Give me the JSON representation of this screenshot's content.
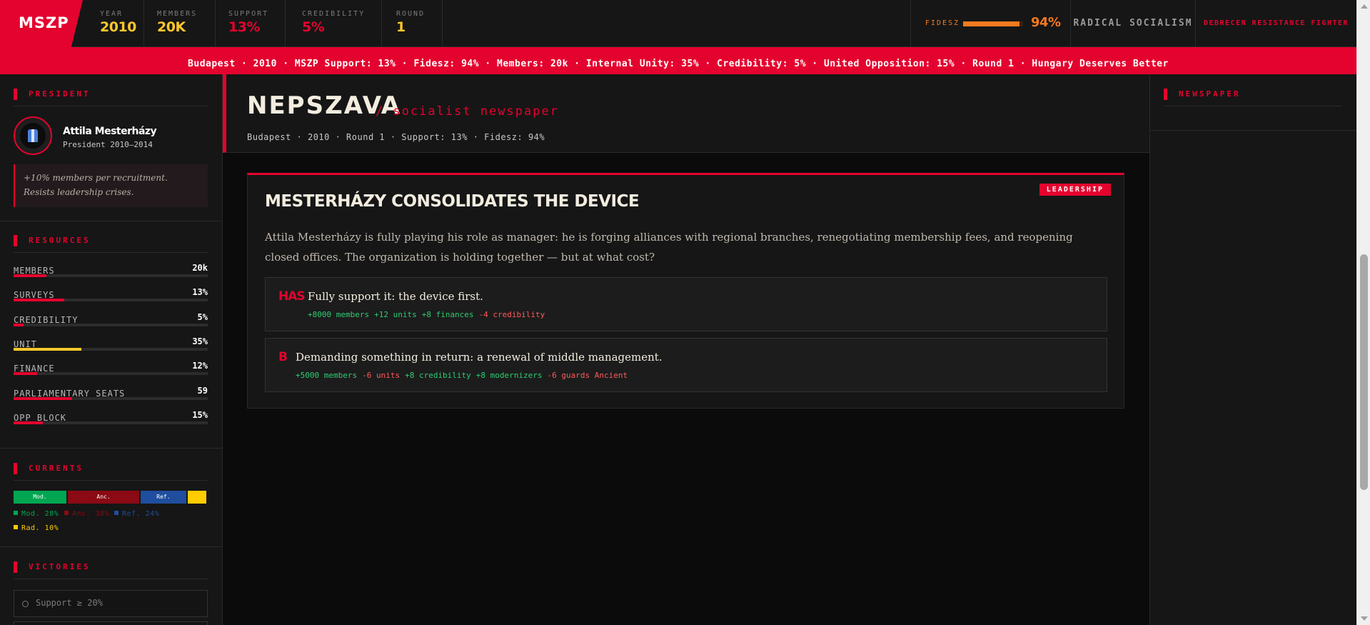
{
  "app": {
    "logo": "MSZP"
  },
  "stats": [
    {
      "label": "YEAR",
      "value": "2010",
      "color": "yellow"
    },
    {
      "label": "MEMBERS",
      "value": "20K",
      "color": "yellow"
    },
    {
      "label": "SUPPORT",
      "value": "13%",
      "color": "red"
    },
    {
      "label": "CREDIBILITY",
      "value": "5%",
      "color": "red"
    },
    {
      "label": "ROUND",
      "value": "1",
      "color": "yellow"
    }
  ],
  "fidesz": {
    "label": "FIDESZ",
    "value": "94%",
    "level": 0.94,
    "color": "#f47a1f"
  },
  "ideology": "RADICAL SOCIALISM",
  "role": "DEBRECEN RESISTANCE FIGHTER",
  "ticker": "Budapest · 2010 · MSZP Support: 13% · Fidesz: 94% · Members: 20k · Internal Unity: 35% · Credibility: 5% · United Opposition: 15% · Round 1 · Hungary Deserves Better",
  "sidebar": {
    "president": {
      "title": "PRESIDENT",
      "name": "Attila Mesterházy",
      "term": "President 2010–2014",
      "perk": "+10% members per recruitment. Resists leadership crises."
    },
    "resources": {
      "title": "RESOURCES",
      "items": [
        {
          "name": "MEMBERS",
          "value": "20k",
          "level": 0.17,
          "color": "#e4032e"
        },
        {
          "name": "SURVEYS",
          "value": "13%",
          "level": 0.26,
          "color": "#e4032e"
        },
        {
          "name": "CREDIBILITY",
          "value": "5%",
          "level": 0.05,
          "color": "#e4032e"
        },
        {
          "name": "UNIT",
          "value": "35%",
          "level": 0.35,
          "color": "#ffc72c"
        },
        {
          "name": "FINANCE",
          "value": "12%",
          "level": 0.12,
          "color": "#e4032e"
        },
        {
          "name": "PARLIAMENTARY SEATS",
          "value": "59",
          "level": 0.3,
          "color": "#e4032e"
        },
        {
          "name": "OPP BLOCK",
          "value": "15%",
          "level": 0.15,
          "color": "#e4032e"
        }
      ]
    },
    "currents": {
      "title": "CURRENTS",
      "segments": [
        {
          "label": "Mod.",
          "share": 28,
          "color": "#00a651"
        },
        {
          "label": "Anc.",
          "share": 38,
          "color": "#8b0a14"
        },
        {
          "label": "Ref.",
          "share": 24,
          "color": "#1f4e9e"
        },
        {
          "label": "",
          "share": 10,
          "color": "#ffcc00"
        }
      ],
      "legend": [
        {
          "text": "Mod. 28%",
          "color": "#00a651"
        },
        {
          "text": "Anc. 38%",
          "color": "#8b0a14"
        },
        {
          "text": "Ref. 24%",
          "color": "#1f4e9e"
        },
        {
          "text": "Rad. 10%",
          "color": "#ffcc00"
        }
      ]
    },
    "victories": {
      "title": "VICTORIES",
      "items": [
        "Support ≥ 20%"
      ]
    }
  },
  "newspaper": {
    "title": "NEPSZAVA",
    "subtitle": "/ socialist newspaper",
    "meta": "Budapest · 2010 · Round 1 · Support: 13% · Fidesz: 94%"
  },
  "event": {
    "tag": "LEADERSHIP",
    "title": "MESTERHÁZY CONSOLIDATES THE DEVICE",
    "body": "Attila Mesterházy is fully playing his role as manager: he is forging alliances with regional branches, renegotiating membership fees, and reopening closed offices. The organization is holding together — but at what cost?",
    "options": [
      {
        "key": "HAS",
        "text": "Fully support it: the device first.",
        "effects": [
          {
            "text": "+8000 members",
            "tone": "g"
          },
          {
            "text": "+12 units",
            "tone": "g"
          },
          {
            "text": "+8 finances",
            "tone": "g"
          },
          {
            "text": "-4 credibility",
            "tone": "r"
          }
        ]
      },
      {
        "key": "B",
        "text": "Demanding something in return: a renewal of middle management.",
        "effects": [
          {
            "text": "+5000 members",
            "tone": "g"
          },
          {
            "text": "-6 units",
            "tone": "r"
          },
          {
            "text": "+8 credibility",
            "tone": "g"
          },
          {
            "text": "+8 modernizers",
            "tone": "g"
          },
          {
            "text": "-6 guards Ancient",
            "tone": "r"
          }
        ]
      }
    ]
  },
  "right_panel": {
    "title": "NEWSPAPER"
  }
}
